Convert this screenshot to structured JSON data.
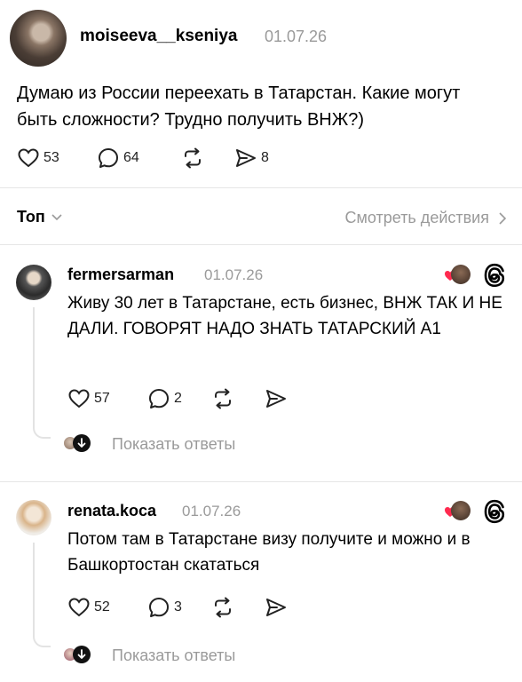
{
  "post": {
    "username": "moiseeva__kseniya",
    "date": "01.07.26",
    "text": "Думаю из России переехать в Татарстан. Какие могут быть сложности? Трудно получить ВНЖ?)",
    "likes": "53",
    "replies": "64",
    "shares": "8"
  },
  "sortbar": {
    "sort_label": "Топ",
    "view_activity": "Смотреть действия"
  },
  "comments": [
    {
      "username": "fermersarman",
      "date": "01.07.26",
      "text": "Живу 30 лет в Татарстане, есть бизнес, ВНЖ ТАК И НЕ ДАЛИ. ГОВОРЯТ НАДО ЗНАТЬ ТАТАРСКИЙ А1",
      "likes": "57",
      "replies": "2",
      "show_replies": "Показать ответы"
    },
    {
      "username": "renata.koca",
      "date": "01.07.26",
      "text": "Потом там в Татарстане визу получите и можно и в Башкортостан скататься",
      "likes": "52",
      "replies": "3",
      "show_replies": "Показать ответы"
    }
  ],
  "colors": {
    "heart_red": "#ff2a4f",
    "muted": "#9a9a9a"
  }
}
